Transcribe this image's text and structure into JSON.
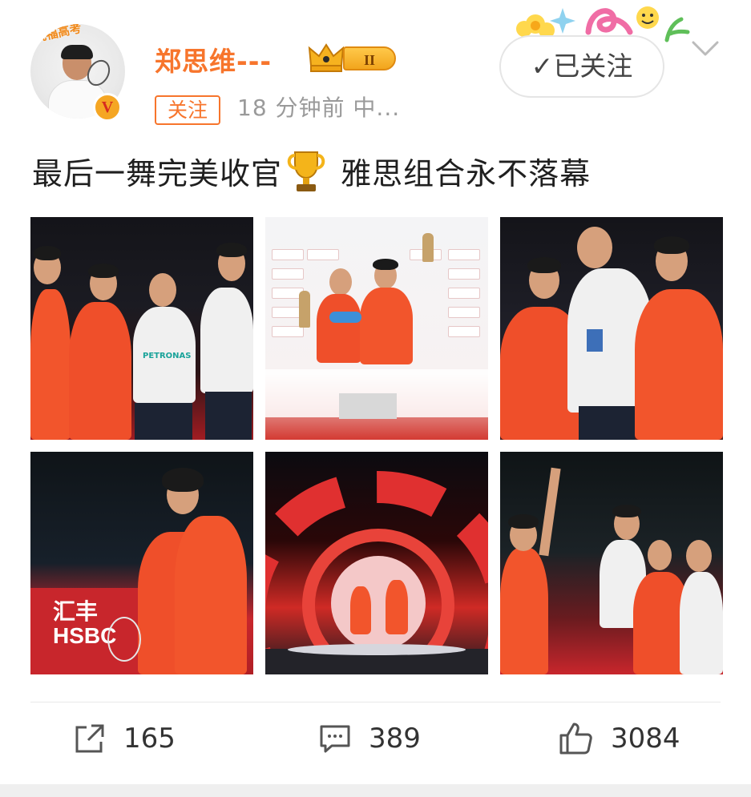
{
  "post": {
    "avatar_banner": "祝福高考",
    "username": "郑思维---",
    "level_badge": "II",
    "follow_tag": "关注",
    "meta": "18 分钟前   中...",
    "followed_button": "✓已关注",
    "text_before": "最后一舞完美收官",
    "text_after": " 雅思组合永不落幕",
    "photo_text": {
      "hsbc_cn": "汇丰",
      "hsbc_en": "HSBC",
      "petronas": "PETRONAS"
    }
  },
  "actions": {
    "share_count": "165",
    "comment_count": "389",
    "like_count": "3084"
  },
  "icons": {
    "verified": "verified-v-icon",
    "crown": "crown-icon",
    "chevron": "chevron-down-icon",
    "trophy": "trophy-emoji-icon",
    "share": "share-icon",
    "comment": "comment-icon",
    "like": "thumbs-up-icon"
  },
  "colors": {
    "username": "#f7752c",
    "meta": "#9a9a9a",
    "jersey": "#f2552c",
    "hsbc_red": "#c8262c"
  }
}
